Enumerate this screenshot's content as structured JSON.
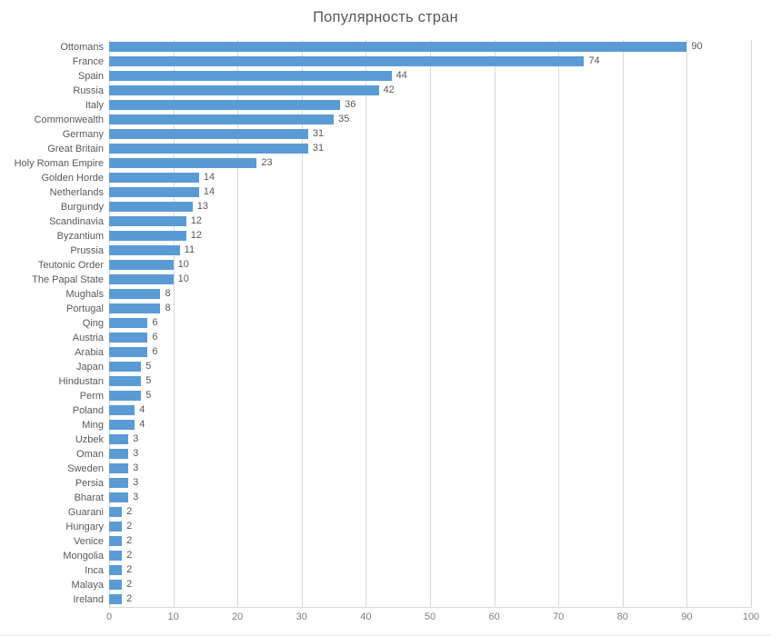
{
  "chart_data": {
    "type": "bar",
    "orientation": "horizontal",
    "title": "Популярность стран",
    "xlabel": "",
    "ylabel": "",
    "xlim": [
      0,
      100
    ],
    "xticks": [
      0,
      10,
      20,
      30,
      40,
      50,
      60,
      70,
      80,
      90,
      100
    ],
    "grid": true,
    "legend": false,
    "bar_color": "#5b9bd5",
    "gridline_color": "#d9d9d9",
    "label_color": "#595959",
    "tick_color": "#7f7f7f",
    "show_data_labels": true,
    "categories": [
      "Ottomans",
      "France",
      "Spain",
      "Russia",
      "Italy",
      "Commonwealth",
      "Germany",
      "Great Britain",
      "Holy Roman Empire",
      "Golden Horde",
      "Netherlands",
      "Burgundy",
      "Scandinavia",
      "Byzantium",
      "Prussia",
      "Teutonic Order",
      "The Papal State",
      "Mughals",
      "Portugal",
      "Qing",
      "Austria",
      "Arabia",
      "Japan",
      "Hindustan",
      "Perm",
      "Poland",
      "Ming",
      "Uzbek",
      "Oman",
      "Sweden",
      "Persia",
      "Bharat",
      "Guarani",
      "Hungary",
      "Venice",
      "Mongolia",
      "Inca",
      "Malaya",
      "Ireland"
    ],
    "values": [
      90,
      74,
      44,
      42,
      36,
      35,
      31,
      31,
      23,
      14,
      14,
      13,
      12,
      12,
      11,
      10,
      10,
      8,
      8,
      6,
      6,
      6,
      5,
      5,
      5,
      4,
      4,
      3,
      3,
      3,
      3,
      3,
      2,
      2,
      2,
      2,
      2,
      2,
      2
    ]
  }
}
